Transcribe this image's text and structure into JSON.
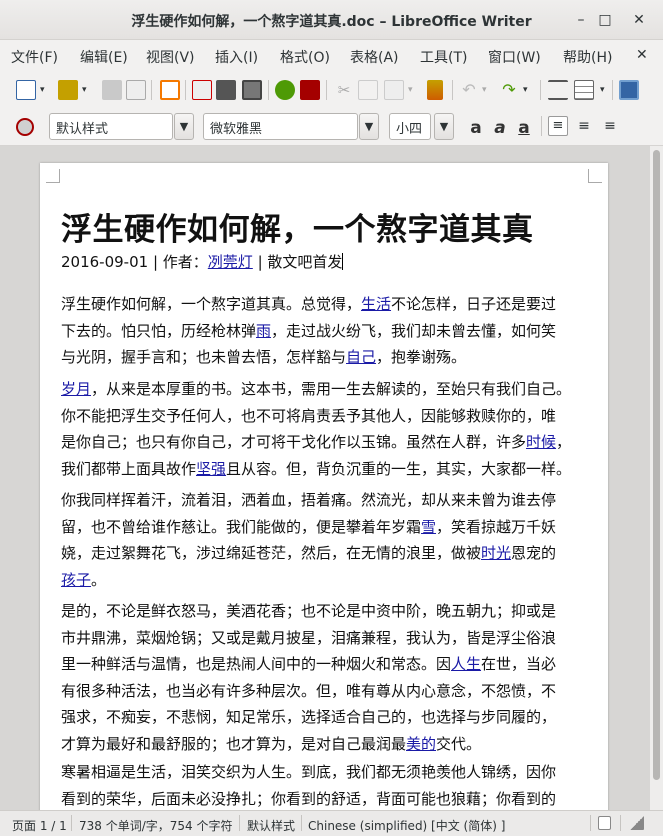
{
  "window": {
    "title": "浮生硬作如何解，一个熬字道其真.doc – LibreOffice Writer",
    "minimize": "–",
    "maximize": "□",
    "close": "✕"
  },
  "menubar": {
    "items": [
      "文件(F)",
      "编辑(E)",
      "视图(V)",
      "插入(I)",
      "格式(O)",
      "表格(A)",
      "工具(T)",
      "窗口(W)",
      "帮助(H)"
    ],
    "close": "✕"
  },
  "formatting": {
    "paragraph_style": "默认样式",
    "font_name": "微软雅黑",
    "font_size": "小四"
  },
  "document": {
    "heading": "浮生硬作如何解，一个熬字道其真",
    "meta": {
      "date": "2016-09-01",
      "author_label": "作者：",
      "author": "冽莞灯",
      "sep1": " | ",
      "sep2": " | ",
      "source": "散文吧首发"
    },
    "paragraphs": [
      {
        "lines": [
          [
            {
              "t": "浮生硬作如何解，一个熬字道其真。总觉得，"
            },
            {
              "t": "生活",
              "link": true
            },
            {
              "t": "不论怎样，日子还是要过"
            }
          ],
          [
            {
              "t": "下去的。怕只怕，历经枪林弹"
            },
            {
              "t": "雨",
              "link": true
            },
            {
              "t": "，走过战火纷飞，我们却未曾去懂，如何笑"
            }
          ],
          [
            {
              "t": "与光阴，握手言和；也未曾去悟，怎样豁与"
            },
            {
              "t": "自己",
              "link": true
            },
            {
              "t": "，抱拳谢殇。"
            }
          ]
        ]
      },
      {
        "lines": [
          [
            {
              "t": "岁月",
              "link": true
            },
            {
              "t": "，从来是本厚重的书。这本书，需用一生去解读的，至始只有我们自己。"
            }
          ],
          [
            {
              "t": "你不能把浮生交予任何人，也不可将肩责丢予其他人，因能够救赎你的，唯"
            }
          ],
          [
            {
              "t": "是你自己；也只有你自己，才可将干戈化作以玉锦。虽然在人群，许多"
            },
            {
              "t": "时候",
              "link": true
            },
            {
              "t": "，"
            }
          ],
          [
            {
              "t": "我们都带上面具故作"
            },
            {
              "t": "坚强",
              "link": true
            },
            {
              "t": "且从容。但，背负沉重的一生，其实，大家都一样。"
            }
          ]
        ]
      },
      {
        "lines": [
          [
            {
              "t": "你我同样挥着汗，流着泪，洒着血，捂着痛。然流光，却从来未曾为谁去停"
            }
          ],
          [
            {
              "t": "留，也不曾给谁作慈让。我们能做的，便是攀着年岁霜"
            },
            {
              "t": "雪",
              "link": true
            },
            {
              "t": "，笑看掠越万千妖"
            }
          ],
          [
            {
              "t": "娆，走过絮舞花飞，涉过绵延苍茫，然后，在无情的浪里，做被"
            },
            {
              "t": "时光",
              "link": true
            },
            {
              "t": "恩宠的"
            }
          ],
          [
            {
              "t": "孩子",
              "link": true
            },
            {
              "t": "。"
            }
          ]
        ]
      },
      {
        "lines": [
          [
            {
              "t": "是的，不论是鲜衣怒马，美酒花香；也不论是中资中阶，晚五朝九；抑或是"
            }
          ],
          [
            {
              "t": "市井鼎沸，菜烟炝锅；又或是戴月披星，泪痛兼程，我认为，皆是浮尘俗浪"
            }
          ],
          [
            {
              "t": "里一种鲜活与温情，也是热闹人间中的一种烟火和常态。因"
            },
            {
              "t": "人生",
              "link": true
            },
            {
              "t": "在世，当必"
            }
          ],
          [
            {
              "t": "有很多种活法，也当必有许多种层次。但，唯有尊从内心意念，不怨愤，不"
            }
          ],
          [
            {
              "t": "强求，不痴妄，不悲悯，知足常乐，选择适合自己的，也选择与步同履的，"
            }
          ],
          [
            {
              "t": "才算为最好和最舒服的；也才算为，是对自己最润最"
            },
            {
              "t": "美的",
              "link": true
            },
            {
              "t": "交代。"
            }
          ]
        ]
      },
      {
        "lines": [
          [
            {
              "t": "寒暑相逼是生活，泪笑交织为人生。到底，我们都无须艳羡他人锦绣，因你"
            }
          ],
          [
            {
              "t": "看到的荣华，后面未必没挣扎；你看到的舒适，背面可能也狼藉；你看到的"
            }
          ]
        ]
      }
    ]
  },
  "statusbar": {
    "page": "页面 1 / 1",
    "words": "738 个单词/字，754 个字符",
    "style": "默认样式",
    "language": "Chinese (simplified) [中文 (简体) ]"
  },
  "colors": {
    "link": "#1a1aa6",
    "page_bg": "#ffffff",
    "canvas_bg": "#d7d6d4"
  }
}
